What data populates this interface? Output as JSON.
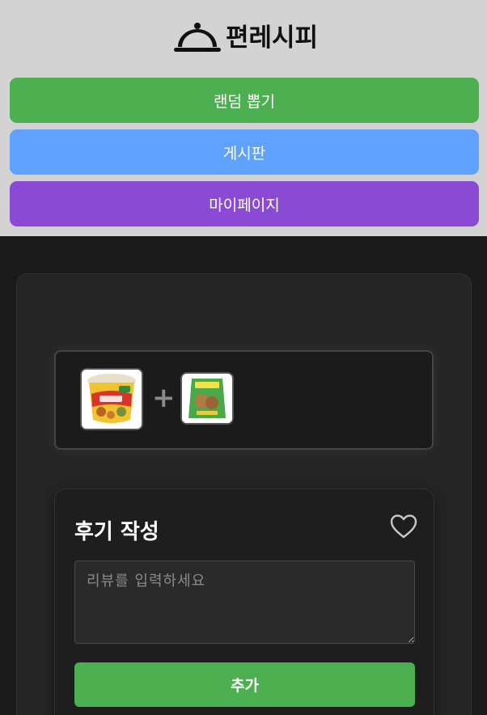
{
  "header": {
    "logo_text": "편레시피",
    "logo_icon": "cloche-icon"
  },
  "nav": {
    "random_label": "랜덤 뽑기",
    "board_label": "게시판",
    "mypage_label": "마이페이지"
  },
  "combo": {
    "products": [
      "ramen-cup-product",
      "snack-bag-product"
    ],
    "separator": "+"
  },
  "review": {
    "title": "후기 작성",
    "like_icon": "heart-outline-icon",
    "input_placeholder": "리뷰를 입력하세요",
    "input_value": "",
    "submit_label": "추가"
  },
  "colors": {
    "random": "#4caf50",
    "board": "#5ea1ff",
    "mypage": "#8a4ad6",
    "submit": "#4caf50"
  }
}
